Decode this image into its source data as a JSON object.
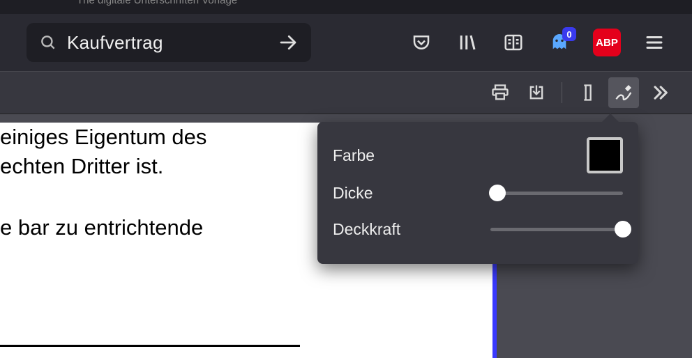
{
  "tab_title_fragment": "The digitale Unterschriften Vorlage",
  "urlbar": {
    "text": "Kaufvertrag"
  },
  "nav_icons": {
    "pocket": "pocket-icon",
    "library": "library-icon",
    "reader": "reader-view-icon",
    "ghostery_badge": "0",
    "abp_label": "ABP",
    "menu": "hamburger-menu-icon"
  },
  "pdf_toolbar": {
    "print": "print-icon",
    "download": "download-icon",
    "text": "text-tool-icon",
    "draw": "draw-tool-icon",
    "more": "more-tools-icon"
  },
  "document": {
    "line1": "einiges Eigentum des",
    "line2": "echten Dritter ist.",
    "line3": "e bar zu entrichtende"
  },
  "draw_popover": {
    "color_label": "Farbe",
    "color_value": "#000000",
    "thickness_label": "Dicke",
    "thickness_percent": 5,
    "opacity_label": "Deckkraft",
    "opacity_percent": 100
  }
}
